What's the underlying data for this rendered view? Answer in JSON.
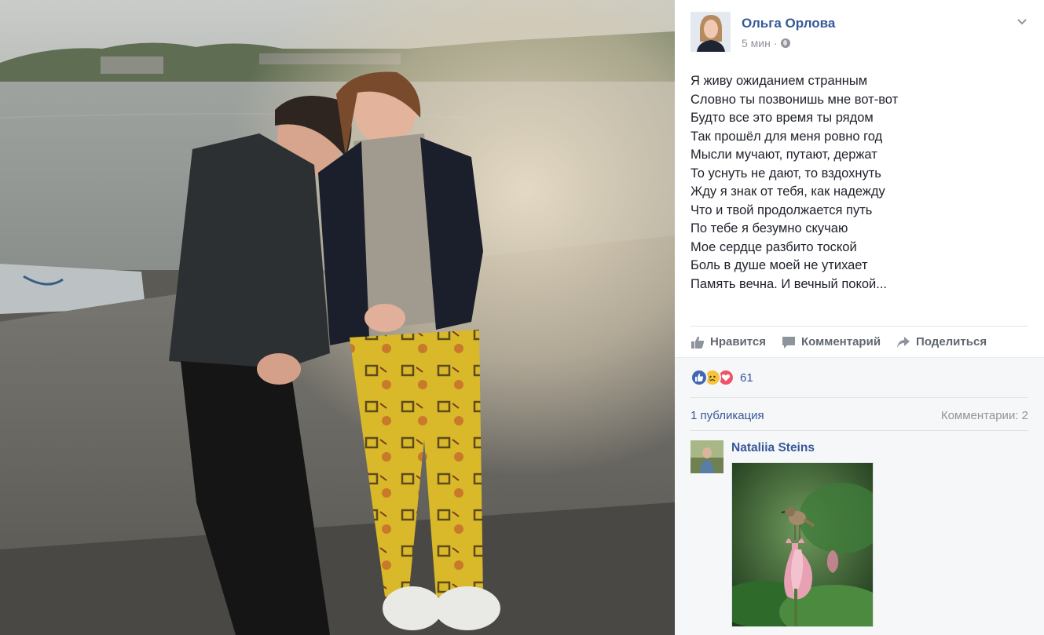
{
  "post": {
    "author": "Ольга Орлова",
    "time": "5 мин",
    "separator": "·",
    "lines": [
      "Я живу ожиданием странным",
      "Словно ты позвонишь мне вот-вот",
      "Будто все это время ты рядом",
      "Так прошёл для меня ровно год",
      "Мысли мучают, путают, держат",
      "То уснуть не дают, то вздохнуть",
      "Жду я знак от тебя, как надежду",
      "Что и твой продолжается путь",
      "По тебе я безумно скучаю",
      "Мое сердце разбито тоской",
      "Боль в душе моей не утихает",
      "Память вечна. И вечный покой..."
    ]
  },
  "actions": {
    "like": "Нравится",
    "comment": "Комментарий",
    "share": "Поделиться"
  },
  "stats": {
    "reactions_count": "61",
    "publications": "1 публикация",
    "comments": "Комментарии: 2"
  },
  "comment": {
    "author": "Nataliia Steins"
  },
  "colors": {
    "link": "#365899",
    "muted": "#90949c",
    "panel_bg": "#f6f7f9",
    "like_blue": "#4267b2",
    "love_red": "#f25268"
  },
  "icons": [
    "globe-icon",
    "chevron-down-icon",
    "like-icon",
    "comment-icon",
    "share-icon",
    "like-reaction-icon",
    "sad-reaction-icon",
    "love-reaction-icon"
  ]
}
